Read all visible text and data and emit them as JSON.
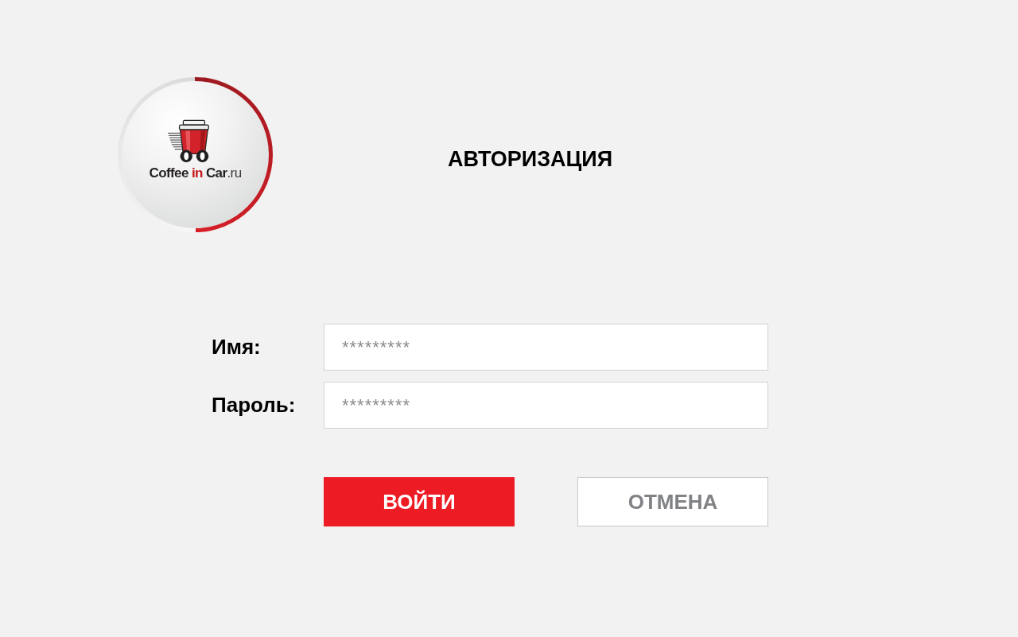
{
  "logo": {
    "wordmark": [
      {
        "text": "Coffee ",
        "kind": "main"
      },
      {
        "text": "in ",
        "kind": "accent"
      },
      {
        "text": "Car",
        "kind": "main"
      },
      {
        "text": ".ru",
        "kind": "domain"
      }
    ]
  },
  "title": "АВТОРИЗАЦИЯ",
  "form": {
    "fields": [
      {
        "label": "Имя:",
        "placeholder": "*********"
      },
      {
        "label": "Пароль:",
        "placeholder": "*********"
      }
    ]
  },
  "buttons": [
    {
      "label": "ВОЙТИ",
      "kind": "primary"
    },
    {
      "label": "ОТМЕНА",
      "kind": "secondary"
    }
  ]
}
